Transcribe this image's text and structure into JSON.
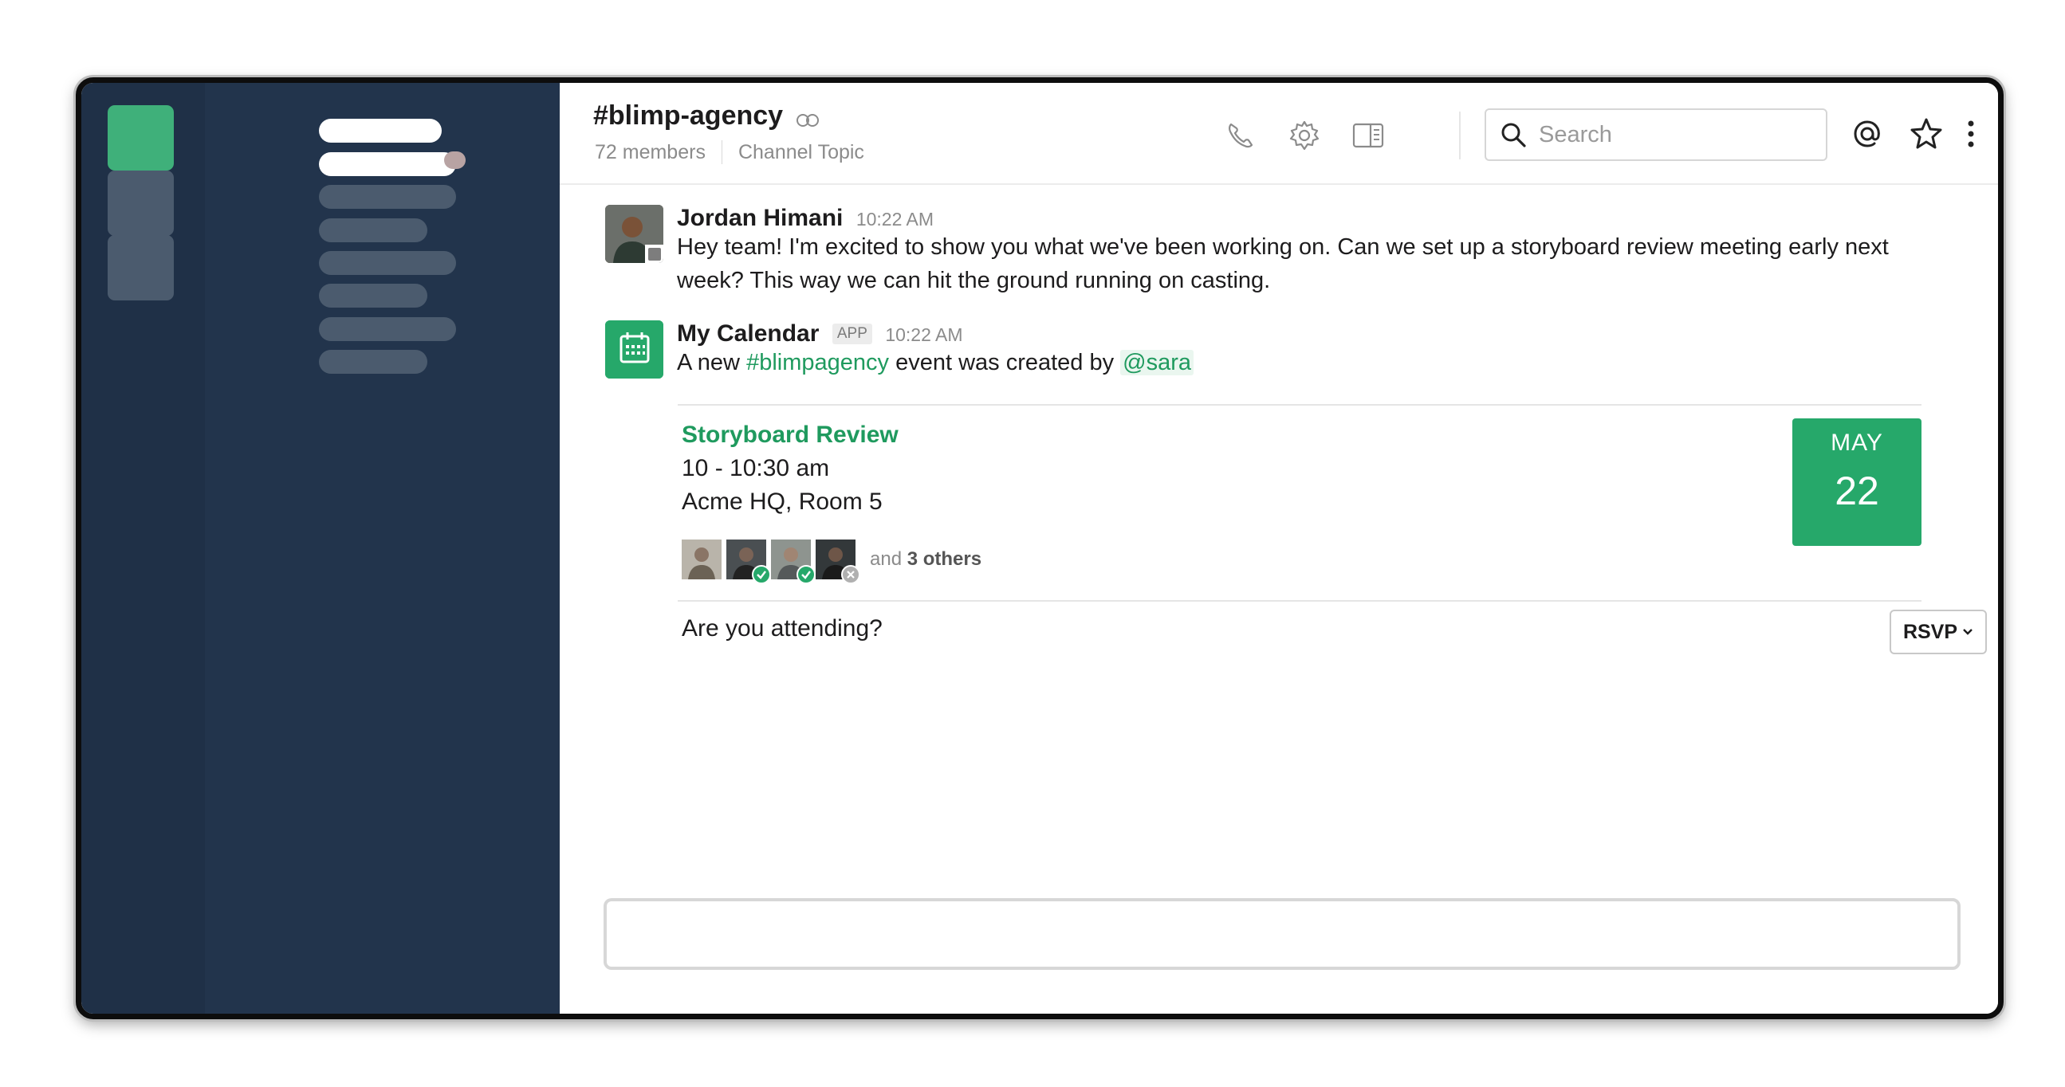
{
  "colors": {
    "team_rail": "#1f3047",
    "sidebar": "#22344c",
    "accent_green": "#26a86a",
    "link_green": "#1f9a5e",
    "placeholder_bar": "#4b5b6e",
    "active_bar": "#ffffff",
    "unread_dot": "#b8a3a3"
  },
  "header": {
    "channel_name": "#blimp-agency",
    "members": "72 members",
    "topic": "Channel Topic",
    "search_placeholder": "Search",
    "icons": [
      "phone-icon",
      "gear-icon",
      "sidebar-toggle-icon",
      "search-icon",
      "at-mention-icon",
      "star-icon",
      "more-vertical-icon"
    ]
  },
  "messages": [
    {
      "author": "Jordan Himani",
      "time": "10:22 AM",
      "text": "Hey team! I'm excited to show you what we've been working on. Can we set up a storyboard review meeting early next week? This way we can hit the ground running on casting."
    },
    {
      "author": "My Calendar",
      "badge": "APP",
      "time": "10:22 AM",
      "text_before": "A new ",
      "channel_link": "#blimpagency",
      "text_middle": " event was created by ",
      "mention": "@sara"
    }
  ],
  "event": {
    "title": "Storyboard Review",
    "time": "10 - 10:30 am",
    "location": "Acme HQ, Room 5",
    "others_prefix": "and",
    "others_count": "3 others",
    "month": "MAY",
    "day": "22",
    "question": "Are you attending?",
    "rsvp_label": "RSVP"
  }
}
